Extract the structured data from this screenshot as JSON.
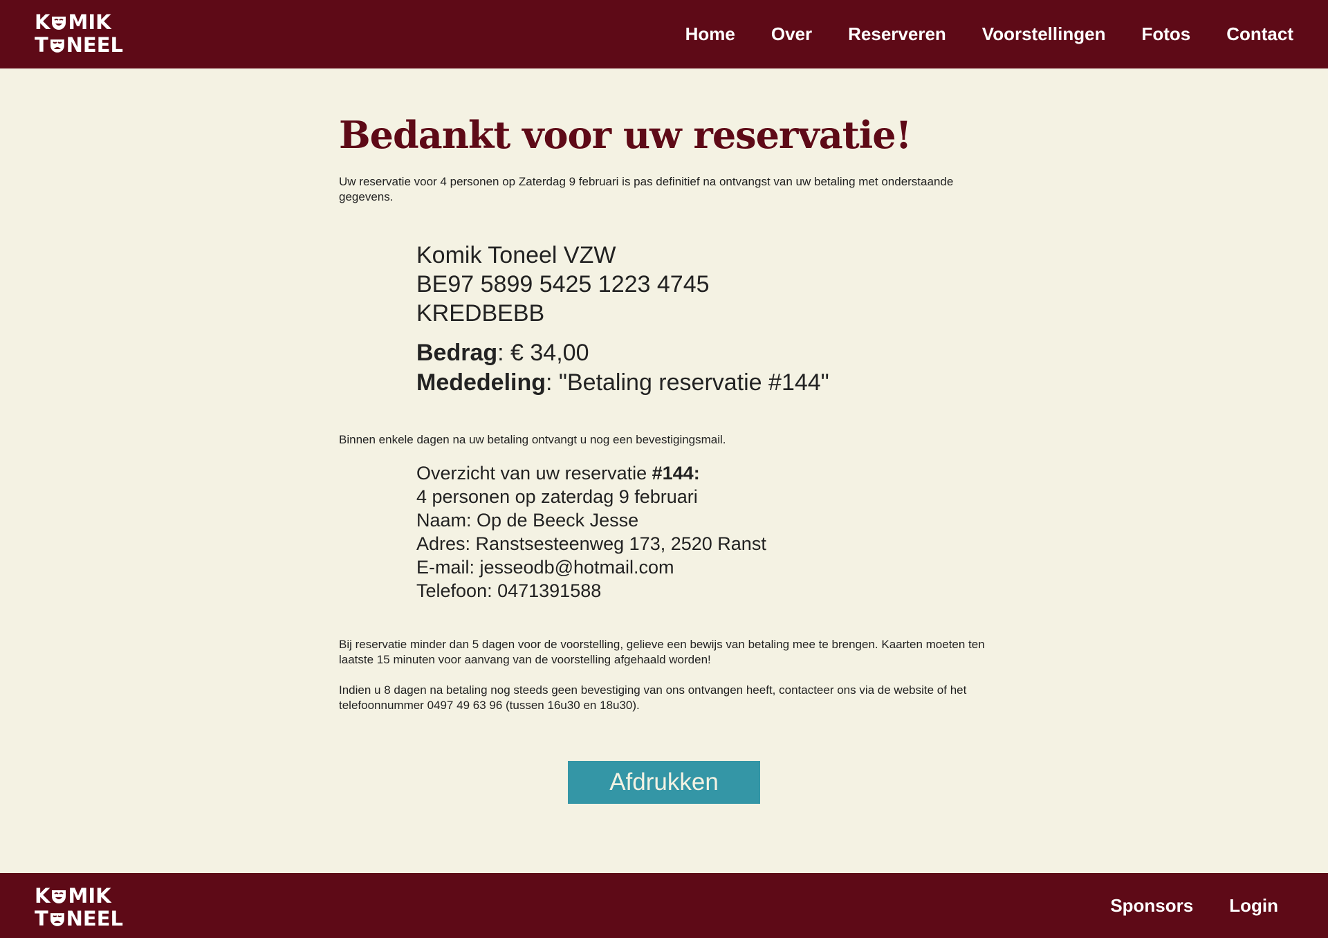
{
  "brand": {
    "logo_top": "K",
    "logo_top_rest": "MIK",
    "logo_bottom": "T",
    "logo_bottom_rest": "NEEL",
    "primary_color": "#5e0a17",
    "background_color": "#f4f2e3",
    "button_color": "#3496a6"
  },
  "nav": {
    "items": [
      {
        "label": "Home"
      },
      {
        "label": "Over"
      },
      {
        "label": "Reserveren"
      },
      {
        "label": "Voorstellingen"
      },
      {
        "label": "Fotos"
      },
      {
        "label": "Contact"
      }
    ]
  },
  "main": {
    "title": "Bedankt voor uw reservatie!",
    "intro": "Uw reservatie voor 4 personen op Zaterdag 9 februari is pas definitief na ontvangst van uw betaling met onderstaande gegevens.",
    "bank": {
      "name": "Komik Toneel VZW",
      "iban": "BE97 5899 5425 1223 4745",
      "bic": "KREDBEBB"
    },
    "payment": {
      "amount_label": "Bedrag",
      "amount_value": ": € 34,00",
      "message_label": "Mededeling",
      "message_value": ": \"Betaling reservatie #144\""
    },
    "confirm_note": "Binnen enkele dagen na uw betaling ontvangt u nog een bevestigingsmail.",
    "overview": {
      "heading": "Overzicht van uw reservatie ",
      "heading_number": "#144:",
      "lines": [
        "4 personen op zaterdag 9 februari",
        "Naam: Op de Beeck Jesse",
        "Adres: Ranstsesteenweg 173, 2520 Ranst",
        "E-mail: jesseodb@hotmail.com",
        "Telefoon: 0471391588"
      ]
    },
    "rules_note": "Bij reservatie minder dan 5 dagen voor de voorstelling, gelieve een bewijs van betaling mee te brengen. Kaarten moeten ten laatste 15 minuten voor aanvang van de voorstelling afgehaald worden!",
    "contact_note": "Indien u 8 dagen na betaling nog steeds geen bevestiging van ons ontvangen heeft, contacteer ons via de website of het telefoonnummer 0497 49 63 96 (tussen 16u30 en 18u30).",
    "print_button": "Afdrukken"
  },
  "footer": {
    "links": [
      {
        "label": "Sponsors"
      },
      {
        "label": "Login"
      }
    ]
  },
  "icons": {
    "logo_mask": "theatre-mask-icon"
  }
}
